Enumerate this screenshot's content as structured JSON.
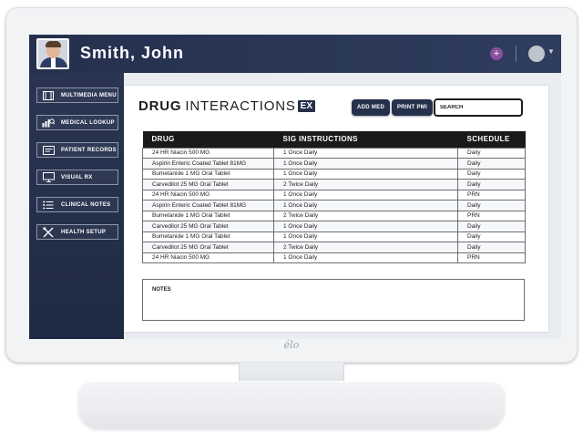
{
  "header": {
    "user_name": "Smith, John",
    "add_symbol": "+"
  },
  "sidebar": {
    "items": [
      {
        "label": "MULTIMEDIA MENU",
        "icon": "video-grid-icon"
      },
      {
        "label": "MEDICAL LOOKUP",
        "icon": "chart-search-icon"
      },
      {
        "label": "PATIENT RECORDS",
        "icon": "folder-records-icon"
      },
      {
        "label": "VISUAL RX",
        "icon": "monitor-icon"
      },
      {
        "label": "CLINICAL NOTES",
        "icon": "list-icon"
      },
      {
        "label": "HEALTH SETUP",
        "icon": "tools-icon"
      }
    ]
  },
  "main": {
    "title_bold": "DRUG",
    "title_light": "INTERACTIONS",
    "title_badge": "EX",
    "add_med_label": "ADD MED",
    "print_pmi_label": "PRINT PMI",
    "search_placeholder": "SEARCH",
    "table": {
      "columns": [
        "DRUG",
        "SIG INSTRUCTIONS",
        "SCHEDULE"
      ],
      "rows": [
        [
          "24 HR Niacin 500 MG",
          "1 Once Daily",
          "Daily"
        ],
        [
          "Aspirin Enteric Coated Tablet 81MG",
          "1 Once Daily",
          "Daily"
        ],
        [
          "Bumetanide 1 MG Oral Tablet",
          "1 Once Daily",
          "Daily"
        ],
        [
          "Carvedilot 25 MG Oral Tablet",
          "2 Twice Daily",
          "Daily"
        ],
        [
          "24 HR Niacin 500 MG",
          "1 Once Daily",
          "PRN"
        ],
        [
          "Aspirin Enteric Coated Tablet 81MG",
          "1 Once Daily",
          "Daily"
        ],
        [
          "Bumetanide 1 MG Oral Tablet",
          "2 Twice Daily",
          "PRN"
        ],
        [
          "Carvedilot 25 MG Oral Tablet",
          "1 Once Daily",
          "Daily"
        ],
        [
          "Bumetanide 1 MG Oral Tablet",
          "1 Once Daily",
          "Daily"
        ],
        [
          "Carvedilot 25 MG Oral Tablet",
          "2 Twice Daily",
          "Daily"
        ],
        [
          "24 HR Niacin 500 MG",
          "1 Once Daily",
          "PRN"
        ]
      ]
    },
    "notes_label": "NOTES"
  },
  "monitor": {
    "brand": "élo"
  },
  "colors": {
    "navy": "#24304c",
    "accent_purple": "#8a4f9e"
  }
}
